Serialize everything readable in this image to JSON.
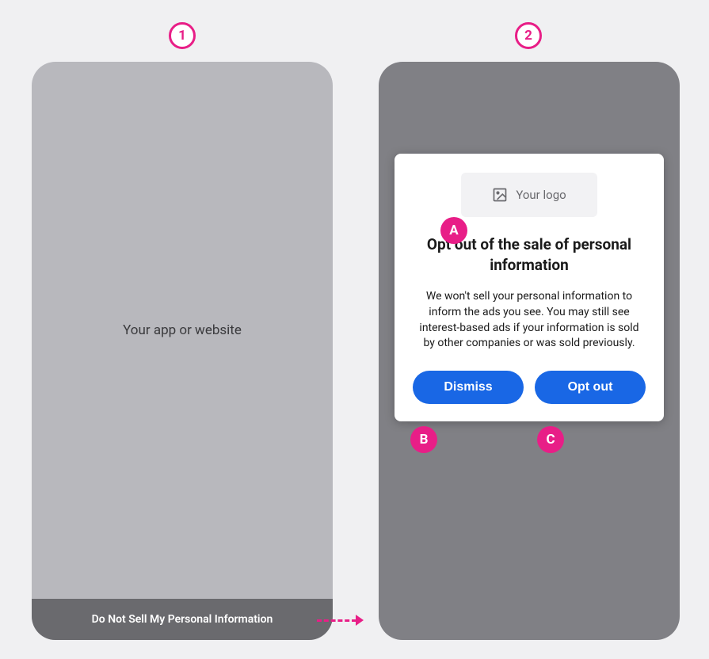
{
  "steps": {
    "one": "1",
    "two": "2"
  },
  "annotations": {
    "a": "A",
    "b": "B",
    "c": "C"
  },
  "screen1": {
    "placeholder": "Your app or website",
    "footer_link": "Do Not Sell My Personal Information"
  },
  "screen2": {
    "logo_placeholder": "Your logo",
    "title": "Opt out of the sale of personal information",
    "body": "We won't sell your personal information to inform the ads you see. You may still see interest-based ads if your information is sold by other companies or was sold previously.",
    "dismiss_label": "Dismiss",
    "optout_label": "Opt out"
  },
  "colors": {
    "accent": "#e81e87",
    "button": "#1967e5"
  }
}
